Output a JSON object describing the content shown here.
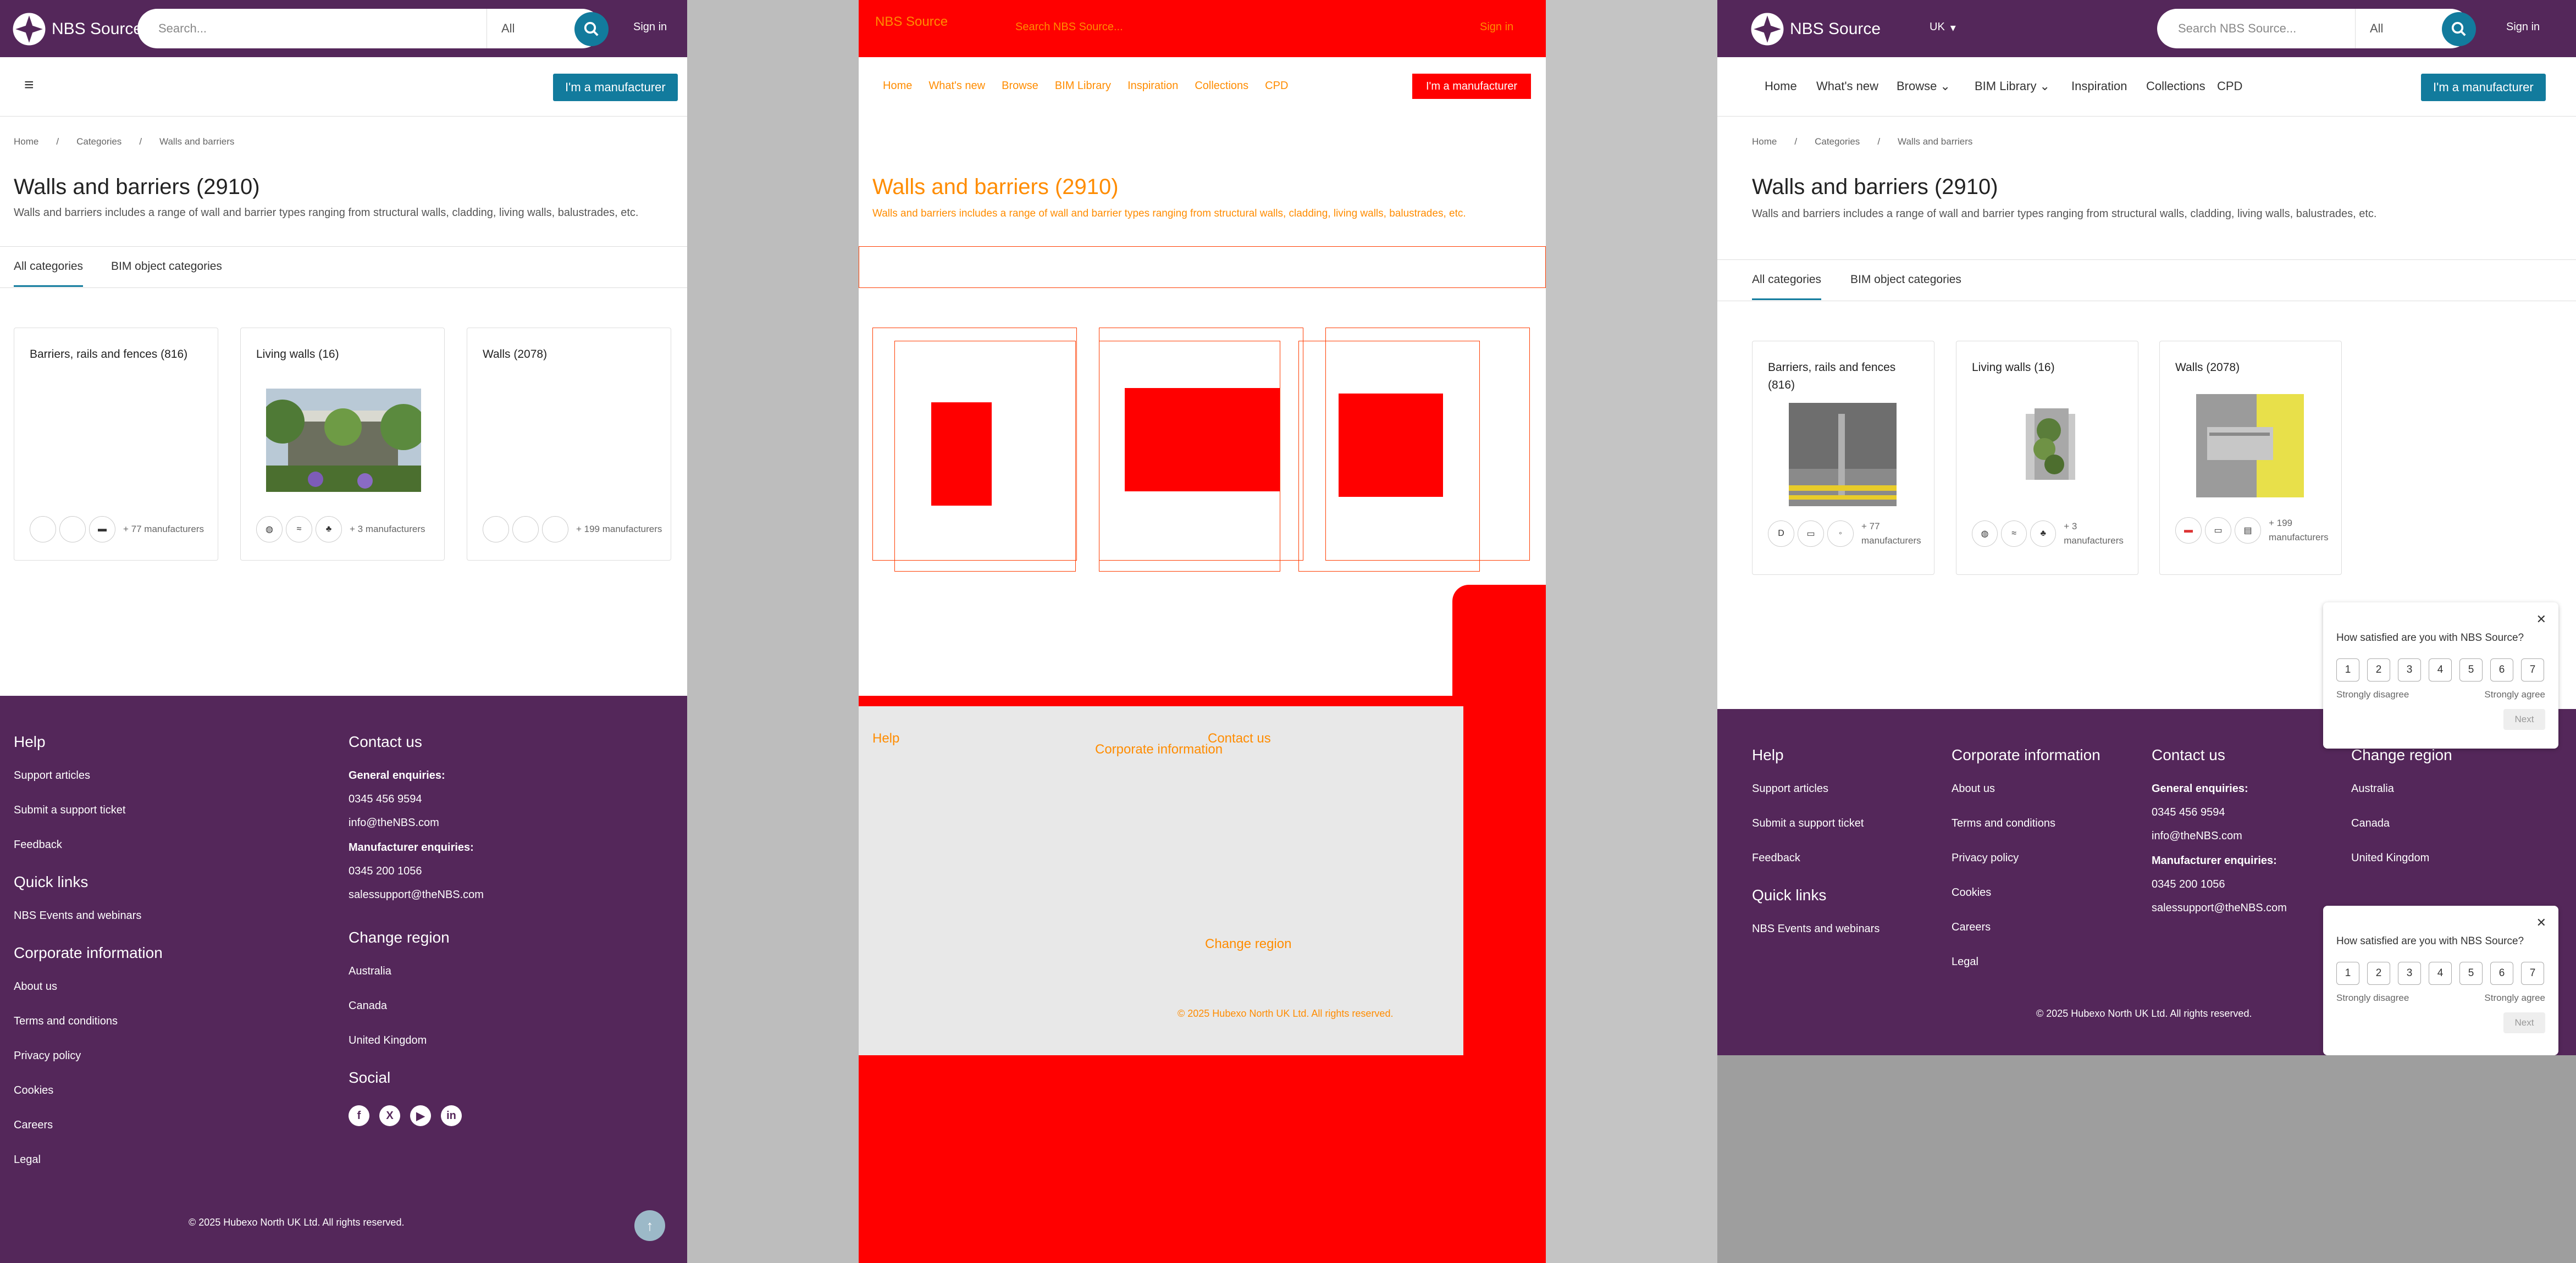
{
  "brand": {
    "name": "NBS Source",
    "primary": "#54275a",
    "accent": "#127b9d",
    "diff": "#ff0000"
  },
  "header": {
    "search_placeholder_left": "Search...",
    "search_placeholder_right": "Search NBS Source...",
    "filter": "All",
    "region": "UK",
    "sign_in": "Sign in"
  },
  "nav": {
    "items": [
      "Home",
      "What's new",
      "Browse",
      "BIM Library",
      "Inspiration",
      "Collections",
      "CPD"
    ],
    "manufacturer_button": "I'm a manufacturer"
  },
  "breadcrumb": [
    "Home",
    "Categories",
    "Walls and barriers"
  ],
  "page": {
    "title": "Walls and barriers (2910)",
    "description": "Walls and barriers includes a range of wall and barrier types ranging from structural walls, cladding, living walls, balustrades, etc."
  },
  "tabs": [
    "All categories",
    "BIM object categories"
  ],
  "cards": [
    {
      "title": "Barriers, rails and fences (816)",
      "title_l1": "Barriers, rails and fences",
      "title_l2": "(816)",
      "mfr": "+ 77 manufacturers",
      "mfr_l1": "+ 77",
      "mfr_l2": "manufacturers"
    },
    {
      "title": "Living walls (16)",
      "mfr": "+ 3 manufacturers"
    },
    {
      "title": "Walls (2078)",
      "mfr": "+ 199 manufacturers",
      "mfr_l1": "+ 199",
      "mfr_l2": "manufacturers"
    }
  ],
  "footer": {
    "help_title": "Help",
    "help": [
      "Support articles",
      "Submit a support ticket",
      "Feedback"
    ],
    "quick_title": "Quick links",
    "quick": [
      "NBS Events and webinars"
    ],
    "corp_title": "Corporate information",
    "corp": [
      "About us",
      "Terms and conditions",
      "Privacy policy",
      "Cookies",
      "Careers",
      "Legal"
    ],
    "contact_title": "Contact us",
    "general_label": "General enquiries:",
    "general_phone": "0345 456 9594",
    "general_email": "info@theNBS.com",
    "mfr_label": "Manufacturer enquiries:",
    "mfr_phone": "0345 200 1056",
    "mfr_email": "salessupport@theNBS.com",
    "region_title": "Change region",
    "regions": [
      "Australia",
      "Canada",
      "United Kingdom"
    ],
    "social_title": "Social",
    "social": [
      "facebook-icon",
      "x-icon",
      "youtube-icon",
      "linkedin-icon"
    ],
    "copyright": "© 2025 Hubexo North UK Ltd. All rights reserved."
  },
  "survey": {
    "question": "How satisfied are you with NBS Source?",
    "scale": [
      "1",
      "2",
      "3",
      "4",
      "5",
      "6",
      "7"
    ],
    "low": "Strongly disagree",
    "high": "Strongly agree",
    "next": "Next"
  }
}
